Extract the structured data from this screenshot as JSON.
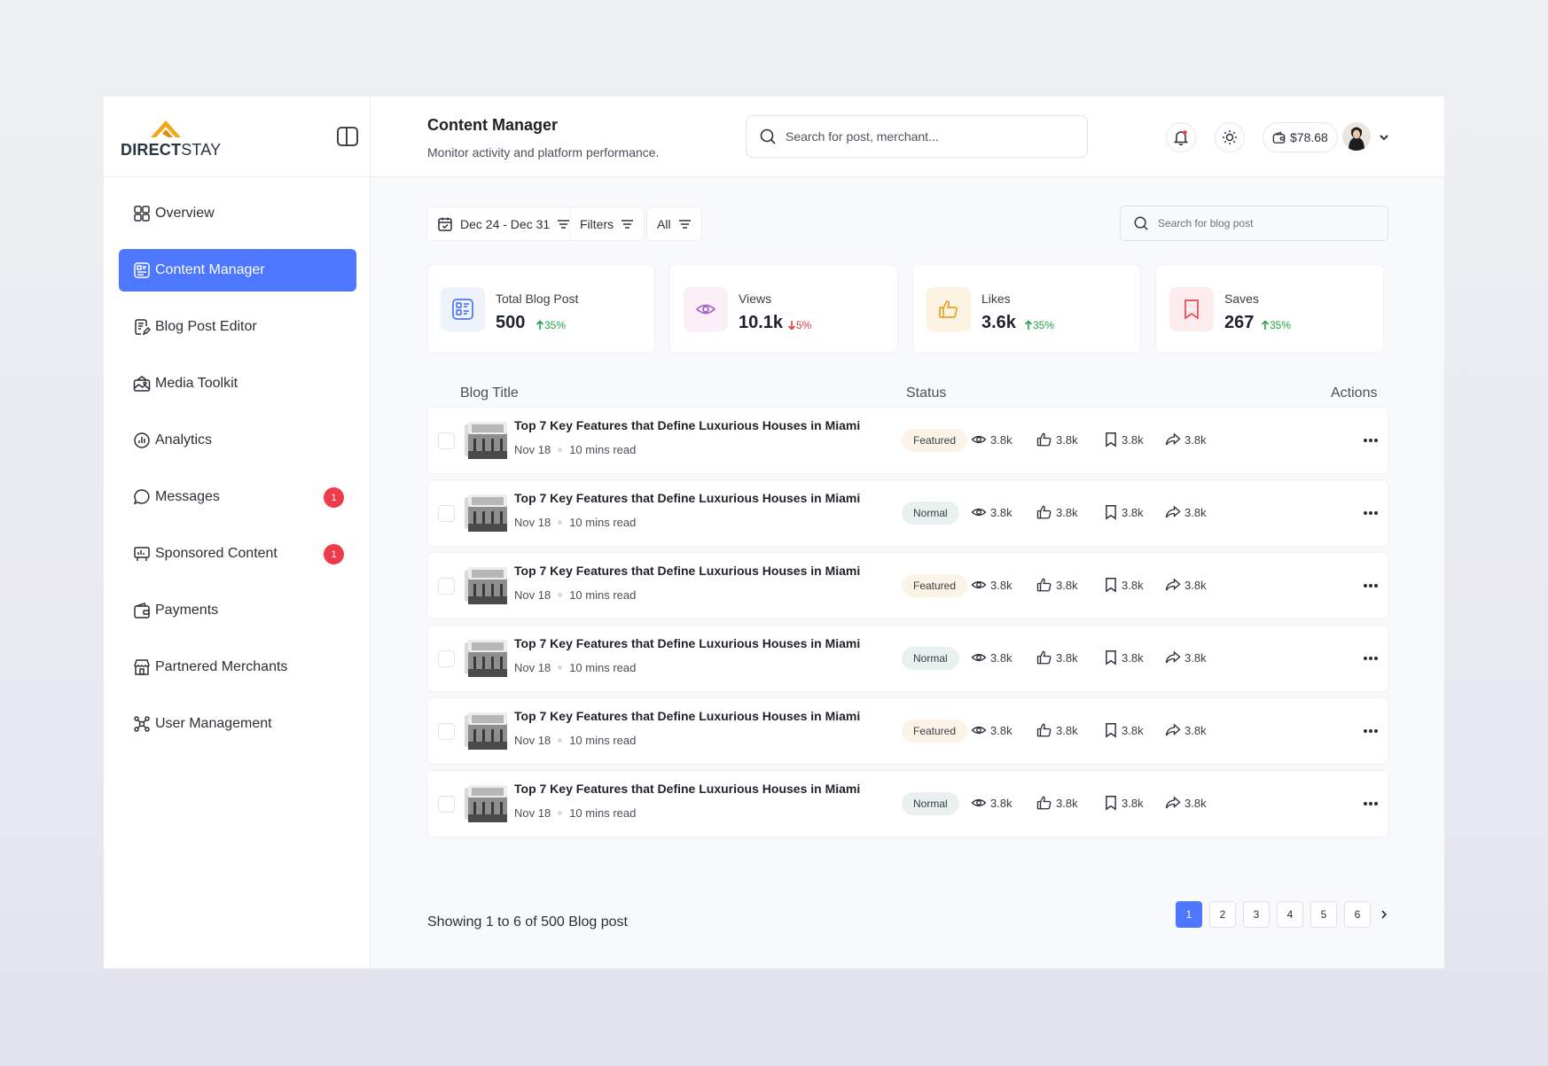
{
  "brand": {
    "name_bold": "DIRECT",
    "name_light": "STAY",
    "accent": "#f1a814"
  },
  "sidebar": {
    "items": [
      {
        "label": "Overview",
        "icon": "grid-icon"
      },
      {
        "label": "Content Manager",
        "icon": "content-icon",
        "active": true
      },
      {
        "label": "Blog Post Editor",
        "icon": "edit-doc-icon"
      },
      {
        "label": "Media Toolkit",
        "icon": "media-icon"
      },
      {
        "label": "Analytics",
        "icon": "analytics-icon"
      },
      {
        "label": "Messages",
        "icon": "chat-icon",
        "badge": "1"
      },
      {
        "label": "Sponsored Content",
        "icon": "billboard-icon",
        "badge": "1"
      },
      {
        "label": "Payments",
        "icon": "wallet-icon"
      },
      {
        "label": "Partnered Merchants",
        "icon": "store-icon"
      },
      {
        "label": "User Management",
        "icon": "users-icon"
      }
    ]
  },
  "header": {
    "title": "Content Manager",
    "subtitle": "Monitor activity and platform performance.",
    "search_placeholder": "Search for post, merchant...",
    "balance": "$78.68"
  },
  "filters": {
    "date_range": "Dec 24 - Dec 31",
    "filters_label": "Filters",
    "all_label": "All",
    "search_placeholder": "Search for blog post"
  },
  "stats": [
    {
      "label": "Total Blog Post",
      "value": "500",
      "delta": "35%",
      "direction": "up"
    },
    {
      "label": "Views",
      "value": "10.1k",
      "delta": "5%",
      "direction": "down"
    },
    {
      "label": "Likes",
      "value": "3.6k",
      "delta": "35%",
      "direction": "up"
    },
    {
      "label": "Saves",
      "value": "267",
      "delta": "35%",
      "direction": "up"
    }
  ],
  "table": {
    "headers": {
      "title": "Blog Title",
      "status": "Status",
      "actions": "Actions"
    },
    "rows": [
      {
        "title": "Top 7 Key Features that Define Luxurious Houses in Miami",
        "date": "Nov 18",
        "read": "10 mins read",
        "status": "Featured",
        "views": "3.8k",
        "likes": "3.8k",
        "saves": "3.8k",
        "shares": "3.8k"
      },
      {
        "title": "Top 7 Key Features that Define Luxurious Houses in Miami",
        "date": "Nov 18",
        "read": "10 mins read",
        "status": "Normal",
        "views": "3.8k",
        "likes": "3.8k",
        "saves": "3.8k",
        "shares": "3.8k"
      },
      {
        "title": "Top 7 Key Features that Define Luxurious Houses in Miami",
        "date": "Nov 18",
        "read": "10 mins read",
        "status": "Featured",
        "views": "3.8k",
        "likes": "3.8k",
        "saves": "3.8k",
        "shares": "3.8k"
      },
      {
        "title": "Top 7 Key Features that Define Luxurious Houses in Miami",
        "date": "Nov 18",
        "read": "10 mins read",
        "status": "Normal",
        "views": "3.8k",
        "likes": "3.8k",
        "saves": "3.8k",
        "shares": "3.8k"
      },
      {
        "title": "Top 7 Key Features that Define Luxurious Houses in Miami",
        "date": "Nov 18",
        "read": "10 mins read",
        "status": "Featured",
        "views": "3.8k",
        "likes": "3.8k",
        "saves": "3.8k",
        "shares": "3.8k"
      },
      {
        "title": "Top 7 Key Features that Define Luxurious Houses in Miami",
        "date": "Nov 18",
        "read": "10 mins read",
        "status": "Normal",
        "views": "3.8k",
        "likes": "3.8k",
        "saves": "3.8k",
        "shares": "3.8k"
      }
    ]
  },
  "footer": {
    "showing": "Showing 1 to 6 of  500 Blog post",
    "pages": [
      "1",
      "2",
      "3",
      "4",
      "5",
      "6"
    ],
    "current_page": "1"
  },
  "colors": {
    "primary": "#4d77ff",
    "badge": "#ee3b4b",
    "up": "#21a24a",
    "down": "#e03b3b"
  }
}
